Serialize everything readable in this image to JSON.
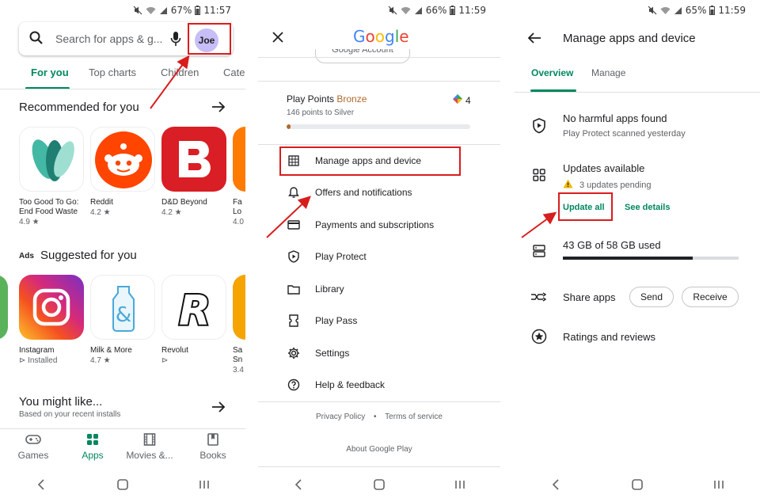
{
  "colors": {
    "accent": "#01875f",
    "highlight": "#d81d1d",
    "bronze": "#b06a2c"
  },
  "phone1": {
    "status": {
      "battery": "67%",
      "time": "11:57"
    },
    "search": {
      "placeholder": "Search for apps & g...",
      "avatar": "Joe"
    },
    "tabs": [
      "For you",
      "Top charts",
      "Children",
      "Cate"
    ],
    "recommended": {
      "title": "Recommended for you",
      "apps": [
        {
          "name": "Too Good To Go:",
          "name2": "End Food Waste",
          "rating": "4.9 ★"
        },
        {
          "name": "Reddit",
          "name2": "",
          "rating": "4.2 ★"
        },
        {
          "name": "D&D Beyond",
          "name2": "",
          "rating": "4.2 ★"
        },
        {
          "name": "Fa",
          "name2": "Lo",
          "rating": "4.0"
        }
      ]
    },
    "suggested": {
      "ads_label": "Ads",
      "title": "Suggested for you",
      "apps": [
        {
          "name": "Instagram",
          "rating": "⊳ Installed"
        },
        {
          "name": "Milk & More",
          "rating": "4.7 ★"
        },
        {
          "name": "Revolut",
          "rating": "⊳"
        },
        {
          "name": "Sa",
          "name2": "Sn",
          "rating": "3.4"
        }
      ]
    },
    "might_like": {
      "title": "You might like...",
      "subtitle": "Based on your recent installs"
    },
    "bottom_nav": [
      "Games",
      "Apps",
      "Movies &...",
      "Books"
    ]
  },
  "phone2": {
    "status": {
      "battery": "66%",
      "time": "11:59"
    },
    "logo": "Google",
    "account_button": "Google Account",
    "play_points": {
      "label": "Play Points",
      "tier": "Bronze",
      "sub": "146 points to Silver",
      "count": "4",
      "progress": 0.02
    },
    "menu": [
      {
        "icon": "grid-icon",
        "label": "Manage apps and device"
      },
      {
        "icon": "bell-icon",
        "label": "Offers and notifications"
      },
      {
        "icon": "card-icon",
        "label": "Payments and subscriptions"
      },
      {
        "icon": "shield-play-icon",
        "label": "Play Protect"
      },
      {
        "icon": "folder-icon",
        "label": "Library"
      },
      {
        "icon": "ticket-icon",
        "label": "Play Pass"
      },
      {
        "icon": "gear-icon",
        "label": "Settings"
      },
      {
        "icon": "help-icon",
        "label": "Help & feedback"
      }
    ],
    "footer": {
      "privacy": "Privacy Policy",
      "terms": "Terms of service",
      "about": "About Google Play"
    }
  },
  "phone3": {
    "status": {
      "battery": "65%",
      "time": "11:59"
    },
    "title": "Manage apps and device",
    "tabs": [
      "Overview",
      "Manage"
    ],
    "protect": {
      "title": "No harmful apps found",
      "sub": "Play Protect scanned yesterday"
    },
    "updates": {
      "title": "Updates available",
      "sub": "3 updates pending",
      "update_all": "Update all",
      "see_details": "See details"
    },
    "storage": {
      "title": "43 GB of 58 GB used",
      "used_fraction": 0.74
    },
    "share": {
      "title": "Share apps",
      "send": "Send",
      "receive": "Receive"
    },
    "ratings": {
      "title": "Ratings and reviews"
    }
  }
}
